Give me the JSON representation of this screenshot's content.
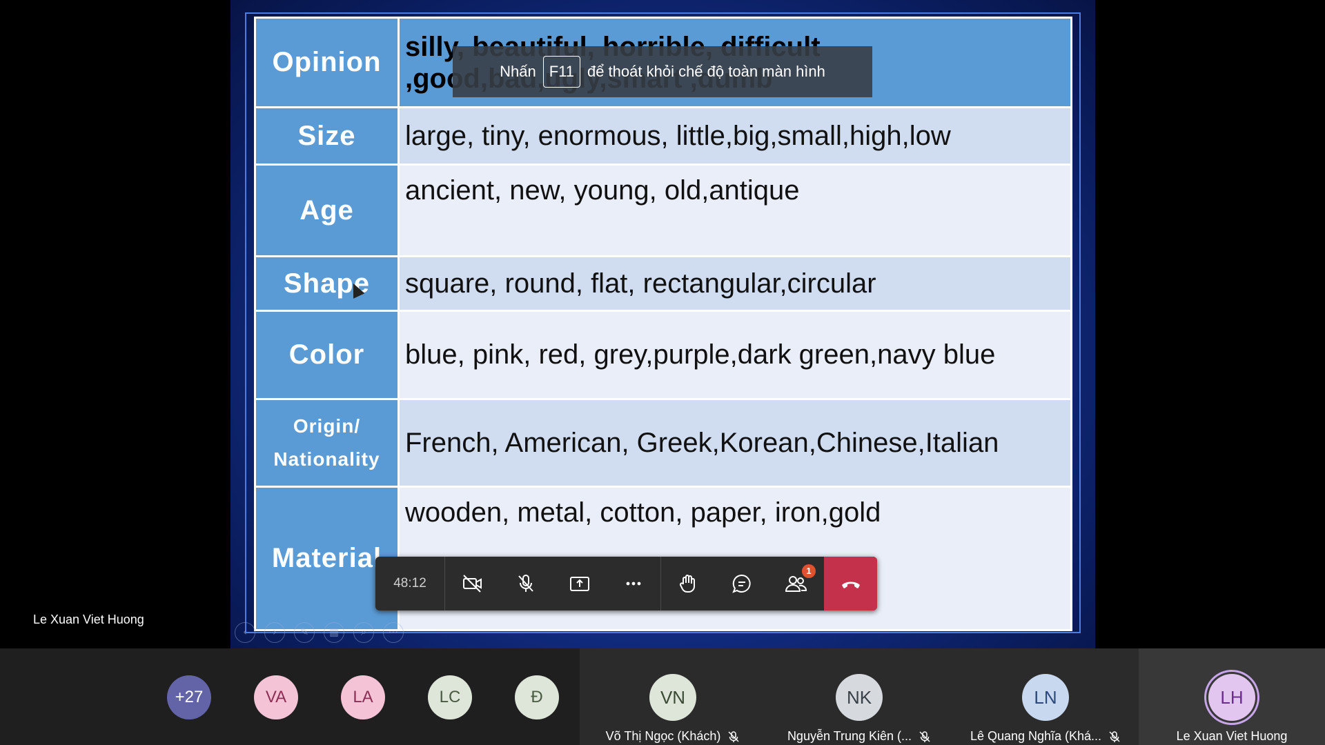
{
  "slide": {
    "rows": [
      {
        "category": "Opinion",
        "words_line1": "silly, beautiful, horrible, difficult",
        "words_line2": ",good,bad,ugly,smart ,dumb"
      },
      {
        "category": "Size",
        "words": "large, tiny, enormous, little,big,small,high,low"
      },
      {
        "category": "Age",
        "words": "ancient, new, young, old,antique"
      },
      {
        "category": "Shape",
        "words": "square, round, flat, rectangular,circular"
      },
      {
        "category": "Color",
        "words": "blue, pink, red, grey,purple,dark green,navy blue"
      },
      {
        "category_line1": "Origin/",
        "category_line2": "Nationality",
        "words": "French, American, Greek,Korean,Chinese,Italian"
      },
      {
        "category": "Material",
        "words": "wooden, metal, cotton, paper, iron,gold"
      }
    ],
    "colors": {
      "header_cell": "#5b9bd5",
      "row_light": "#e9eef8",
      "row_dark": "#d0dcef",
      "background": "#14308a"
    }
  },
  "fullscreen_notice": {
    "prefix": "Nhấn",
    "key": "F11",
    "suffix": "để thoát khỏi chế độ toàn màn hình"
  },
  "presenter": {
    "name": "Le Xuan Viet Huong"
  },
  "call_bar": {
    "timer": "48:12",
    "buttons": [
      "camera-off-icon",
      "mic-off-icon",
      "share-screen-icon",
      "more-icon",
      "raise-hand-icon",
      "chat-icon",
      "participants-icon",
      "hang-up-icon"
    ],
    "participants_badge": "1",
    "hangup_color": "#c4314b"
  },
  "roster": {
    "overflow": {
      "label": "+27",
      "color": "#6264a7"
    },
    "small_avatars": [
      {
        "initials": "VA",
        "bg": "#f4c4d6",
        "fg": "#8c2f55"
      },
      {
        "initials": "LA",
        "bg": "#f4c4d6",
        "fg": "#8c2f55"
      },
      {
        "initials": "LC",
        "bg": "#dde6d8",
        "fg": "#4a5a43"
      },
      {
        "initials": "Đ",
        "bg": "#dde6d8",
        "fg": "#4a5a43"
      }
    ],
    "tiles": [
      {
        "initials": "VN",
        "name": "Võ Thị Ngọc (Khách)",
        "bg": "#dde6d8",
        "fg": "#3b4a35"
      },
      {
        "initials": "NK",
        "name": "Nguyễn Trung Kiên (...",
        "bg": "#d6dadf",
        "fg": "#3a4048"
      },
      {
        "initials": "LN",
        "name": "Lê Quang Nghĩa (Khá...",
        "bg": "#c8d8ef",
        "fg": "#2d4a7a"
      },
      {
        "initials": "LH",
        "name": "Le Xuan Viet Huong",
        "bg": "#e2c6ef",
        "fg": "#6a2d8a"
      }
    ]
  }
}
